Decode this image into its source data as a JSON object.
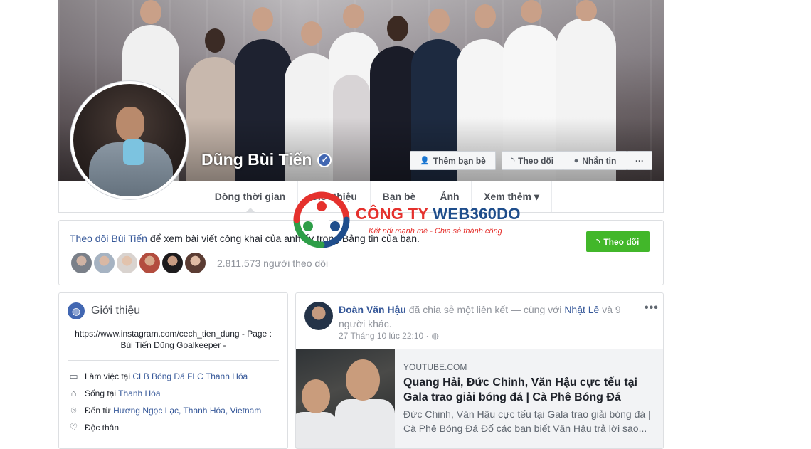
{
  "profile": {
    "name": "Dũng Bùi Tiến",
    "verified": true
  },
  "actions": {
    "add_friend": "Thêm bạn bè",
    "follow": "Theo dõi",
    "message": "Nhắn tin",
    "more": "···"
  },
  "nav": {
    "tabs": [
      {
        "label": "Dòng thời gian",
        "active": true
      },
      {
        "label": "Giới thiệu"
      },
      {
        "label": "Bạn bè"
      },
      {
        "label": "Ảnh"
      },
      {
        "label": "Xem thêm ▾"
      }
    ]
  },
  "follow_box": {
    "link_text": "Theo dõi Bùi Tiến",
    "rest_text": " để xem bài viết công khai của anh ấy trong Bảng tin của bạn.",
    "follower_count": "2.811.573 người theo dõi",
    "follow_button": "Theo dõi"
  },
  "intro": {
    "title": "Giới thiệu",
    "bio": "https://www.instagram.com/cech_tien_dung - Page : Bùi Tiến Dũng Goalkeeper -",
    "rows": [
      {
        "icon": "briefcase-icon",
        "prefix": "Làm việc tại ",
        "link": "CLB Bóng Đá FLC Thanh Hóa"
      },
      {
        "icon": "home-icon",
        "prefix": "Sống tại ",
        "link": "Thanh Hóa"
      },
      {
        "icon": "location-pin-icon",
        "prefix": "Đến từ ",
        "link": "Hương Ngọc Lạc, Thanh Hóa, Vietnam"
      },
      {
        "icon": "heart-icon",
        "prefix": "Độc thân",
        "link": ""
      }
    ]
  },
  "post": {
    "author": "Đoàn Văn Hậu",
    "action": " đã chia sẻ một liên kết — cùng với ",
    "tagged": "Nhật Lê",
    "tagged_more": " và 9 người khác.",
    "timestamp": "27 Tháng 10 lúc 22:10 ·",
    "more": "•••",
    "link": {
      "domain": "YOUTUBE.COM",
      "title": "Quang Hải, Đức Chinh, Văn Hậu cực tếu tại Gala trao giải bóng đá | Cà Phê Bóng Đá",
      "description": "Đức Chinh, Văn Hậu cực tếu tại Gala trao giải bóng đá | Cà Phê Bóng Đá Đố các bạn biết Văn Hậu trả lời sao..."
    }
  },
  "watermark": {
    "word1": "CÔNG TY ",
    "word2": "WEB360DO",
    "slogan": "Kết nối mạnh mẽ - Chia sẻ thành công"
  },
  "colors": {
    "link": "#365899",
    "follow_green": "#42b72a",
    "brand_blue": "#4267b2",
    "watermark_red": "#e5312d",
    "watermark_blue": "#1f4e8c"
  }
}
